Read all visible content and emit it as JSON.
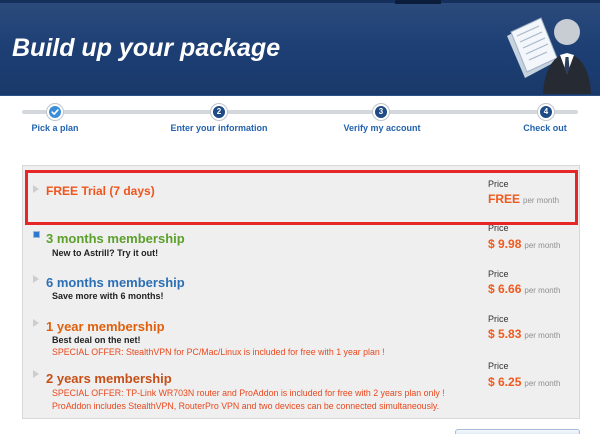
{
  "header": {
    "title": "Build up your package",
    "icon": "user-documents-icon"
  },
  "steps": [
    {
      "icon": "checkmark-icon",
      "label": "Pick a plan"
    },
    {
      "number": "2",
      "label": "Enter your information"
    },
    {
      "number": "3",
      "label": "Verify my account"
    },
    {
      "number": "4",
      "label": "Check out"
    }
  ],
  "plans": [
    {
      "title": "FREE Trial (7 days)",
      "title_color": "#f0541c",
      "marker": "triangle-right-icon",
      "price_label": "Price",
      "price": "FREE",
      "price_unit": "per month",
      "highlighted": true
    },
    {
      "title": "3 months membership",
      "title_color": "#5c9f2c",
      "marker": "selected-square-icon",
      "subtitle": "New to Astrill? Try it out!",
      "price_label": "Price",
      "price": "$ 9.98",
      "price_unit": "per month"
    },
    {
      "title": "6 months membership",
      "title_color": "#2d6fb5",
      "marker": "triangle-right-icon",
      "subtitle": "Save more with 6 months!",
      "price_label": "Price",
      "price": "$ 6.66",
      "price_unit": "per month"
    },
    {
      "title": "1 year membership",
      "title_color": "#e0600e",
      "marker": "triangle-right-icon",
      "subtitle": "Best deal on the net!",
      "offers": [
        "SPECIAL OFFER: StealthVPN for PC/Mac/Linux is included for free with 1 year plan !"
      ],
      "price_label": "Price",
      "price": "$ 5.83",
      "price_unit": "per month"
    },
    {
      "title": "2 years membership",
      "title_color": "#c64f18",
      "marker": "triangle-right-icon",
      "offers": [
        "SPECIAL OFFER: TP-Link WR703N router and ProAddon is included for free with 2 years plan only !",
        "ProAddon includes StealthVPN, RouterPro VPN and two devices can be connected simultaneously."
      ],
      "price_label": "Price",
      "price": "$ 6.25",
      "price_unit": "per month"
    }
  ],
  "colors": {
    "header_bg": "#1c3e73",
    "step_done": "#3a8ed9",
    "step_pending": "#1e4a86",
    "step_label": "#2363ae",
    "price": "#f05a1e",
    "offer": "#e9481d",
    "tagline": "#222222",
    "highlight_border": "#e52727"
  }
}
